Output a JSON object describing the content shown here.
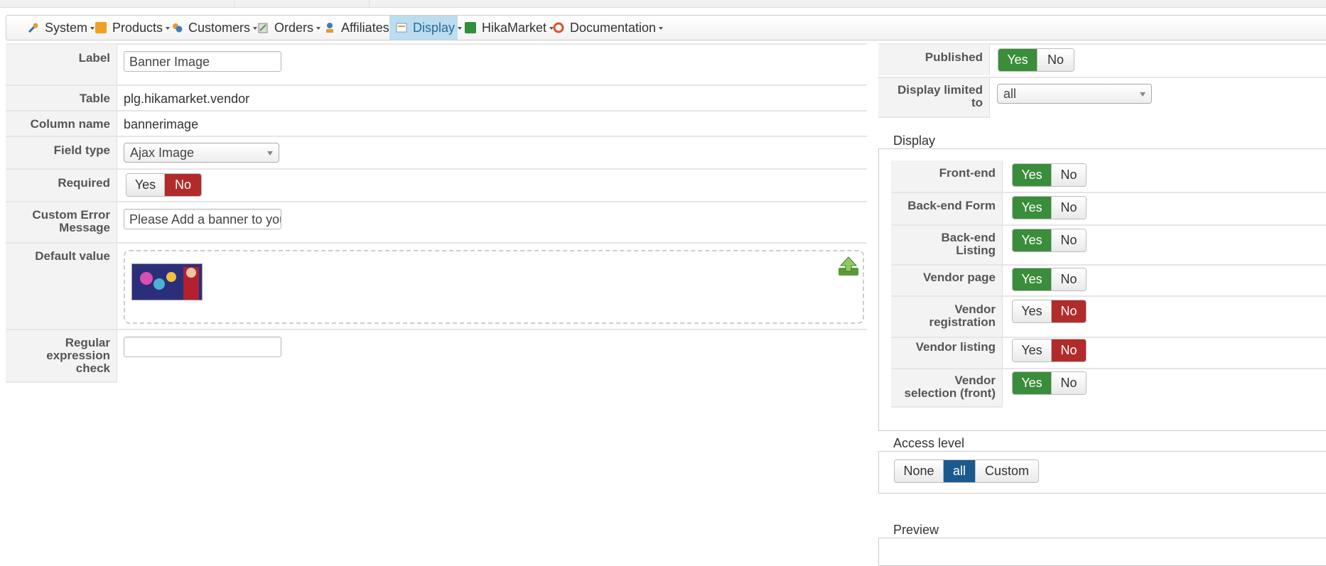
{
  "menu": [
    {
      "label": "System",
      "icon": "tools-icon",
      "active": false
    },
    {
      "label": "Products",
      "icon": "products-icon",
      "active": false
    },
    {
      "label": "Customers",
      "icon": "customers-icon",
      "active": false
    },
    {
      "label": "Orders",
      "icon": "orders-icon",
      "active": false
    },
    {
      "label": "Affiliates",
      "icon": "affiliates-icon",
      "active": true
    },
    {
      "label": "Display",
      "icon": "display-icon",
      "active": true
    },
    {
      "label": "HikaMarket",
      "icon": "hikamarket-icon",
      "active": false
    },
    {
      "label": "Documentation",
      "icon": "lifebuoy-icon",
      "active": false
    }
  ],
  "form": {
    "label_label": "Label",
    "label_value": "Banner Image",
    "table_label": "Table",
    "table_value": "plg.hikamarket.vendor",
    "column_label": "Column name",
    "column_value": "bannerimage",
    "fieldtype_label": "Field type",
    "fieldtype_value": "Ajax Image",
    "required_label": "Required",
    "custom_error_label_1": "Custom Error",
    "custom_error_label_2": "Message",
    "custom_error_value": "Please Add a banner to your",
    "default_label": "Default value",
    "regex_label_1": "Regular",
    "regex_label_2": "expression",
    "regex_label_3": "check",
    "regex_value": ""
  },
  "yes": "Yes",
  "no": "No",
  "right": {
    "published_label": "Published",
    "display_limited_label_1": "Display limited",
    "display_limited_label_2": "to",
    "display_limited_value": "all",
    "display_legend": "Display",
    "frontend_label": "Front-end",
    "backend_form_label": "Back-end Form",
    "backend_listing_label_1": "Back-end",
    "backend_listing_label_2": "Listing",
    "vendor_page_label": "Vendor page",
    "vendor_reg_label_1": "Vendor",
    "vendor_reg_label_2": "registration",
    "vendor_listing_label": "Vendor listing",
    "vendor_sel_label_1": "Vendor",
    "vendor_sel_label_2": "selection (front)",
    "access_legend": "Access level",
    "access_none": "None",
    "access_all": "all",
    "access_custom": "Custom",
    "preview_legend": "Preview"
  },
  "colors": {
    "green": "#3a8d3a",
    "red": "#b22b2b",
    "blue": "#1b5a8f"
  }
}
